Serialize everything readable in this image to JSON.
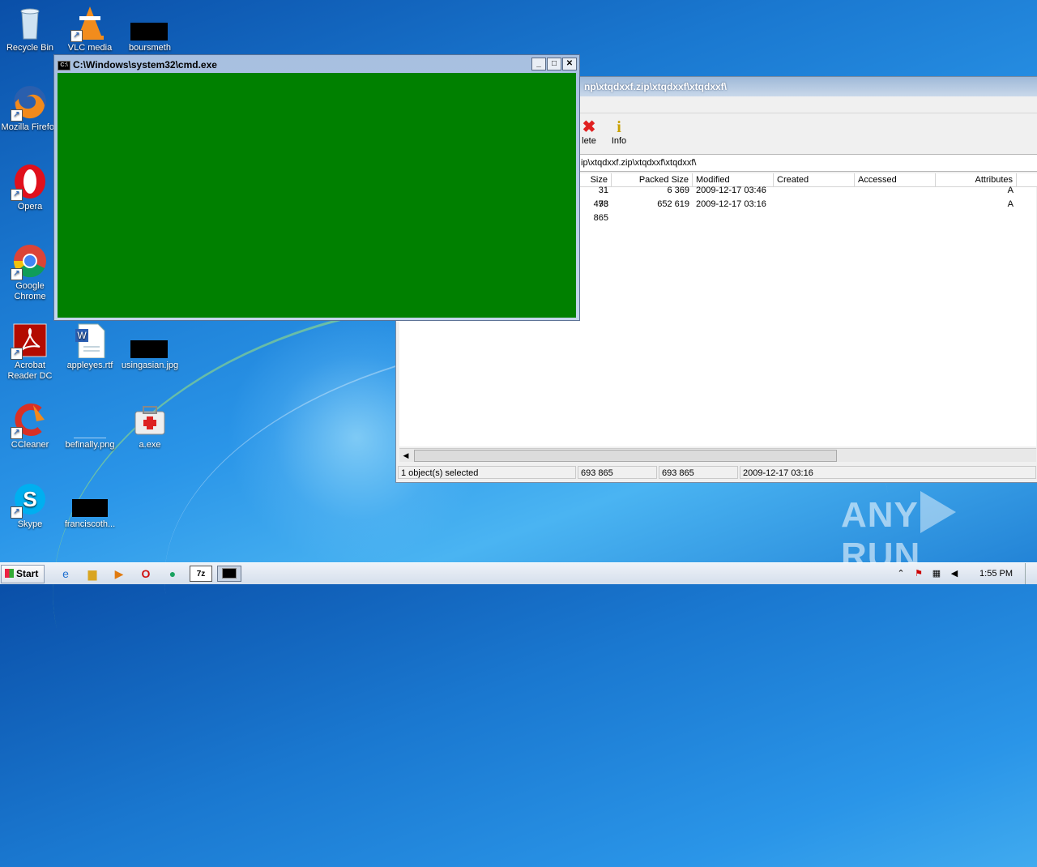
{
  "desktop": {
    "icons": [
      {
        "label": "Recycle Bin",
        "icon": "recycle-bin-icon"
      },
      {
        "label": "VLC media",
        "icon": "vlc-icon"
      },
      {
        "label": "boursmeth",
        "icon": "redacted-file-icon"
      },
      {
        "label": "Mozilla Firefox",
        "icon": "firefox-icon"
      },
      {
        "label": "Opera",
        "icon": "opera-icon"
      },
      {
        "label": "Google Chrome",
        "icon": "chrome-icon"
      },
      {
        "label": "Acrobat Reader DC",
        "icon": "acrobat-icon"
      },
      {
        "label": "appleyes.rtf",
        "icon": "word-doc-icon"
      },
      {
        "label": "usingasian.jpg",
        "icon": "redacted-file-icon"
      },
      {
        "label": "CCleaner",
        "icon": "ccleaner-icon"
      },
      {
        "label": "befinally.png",
        "icon": "png-file-icon"
      },
      {
        "label": "a.exe",
        "icon": "exe-icon"
      },
      {
        "label": "Skype",
        "icon": "skype-icon"
      },
      {
        "label": "franciscoth...",
        "icon": "redacted-file-icon"
      }
    ]
  },
  "cmd": {
    "title": "C:\\Windows\\system32\\cmd.exe",
    "icon_text": "C:\\"
  },
  "zip": {
    "title": "np\\xtqdxxf.zip\\xtqdxxf\\xtqdxxf\\",
    "toolbar": {
      "delete_label": "lete",
      "info_label": "Info"
    },
    "address": "ip\\xtqdxxf.zip\\xtqdxxf\\xtqdxxf\\",
    "columns": [
      "Size",
      "Packed Size",
      "Modified",
      "Created",
      "Accessed",
      "Attributes"
    ],
    "rows": [
      {
        "size": "31 478",
        "packed": "6 369",
        "modified": "2009-12-17 03:46",
        "created": "",
        "accessed": "",
        "attributes": "A"
      },
      {
        "size": "93 865",
        "packed": "652 619",
        "modified": "2009-12-17 03:16",
        "created": "",
        "accessed": "",
        "attributes": "A"
      }
    ],
    "status": {
      "selected": "1 object(s) selected",
      "size": "693 865",
      "packed": "693 865",
      "modified": "2009-12-17 03:16"
    }
  },
  "taskbar": {
    "start_label": "Start",
    "clock": "1:55 PM"
  },
  "watermark": {
    "left": "ANY",
    "right": "RUN"
  },
  "colors": {
    "cmd_background": "#008000",
    "desktop_blue": "#1a78d0"
  }
}
